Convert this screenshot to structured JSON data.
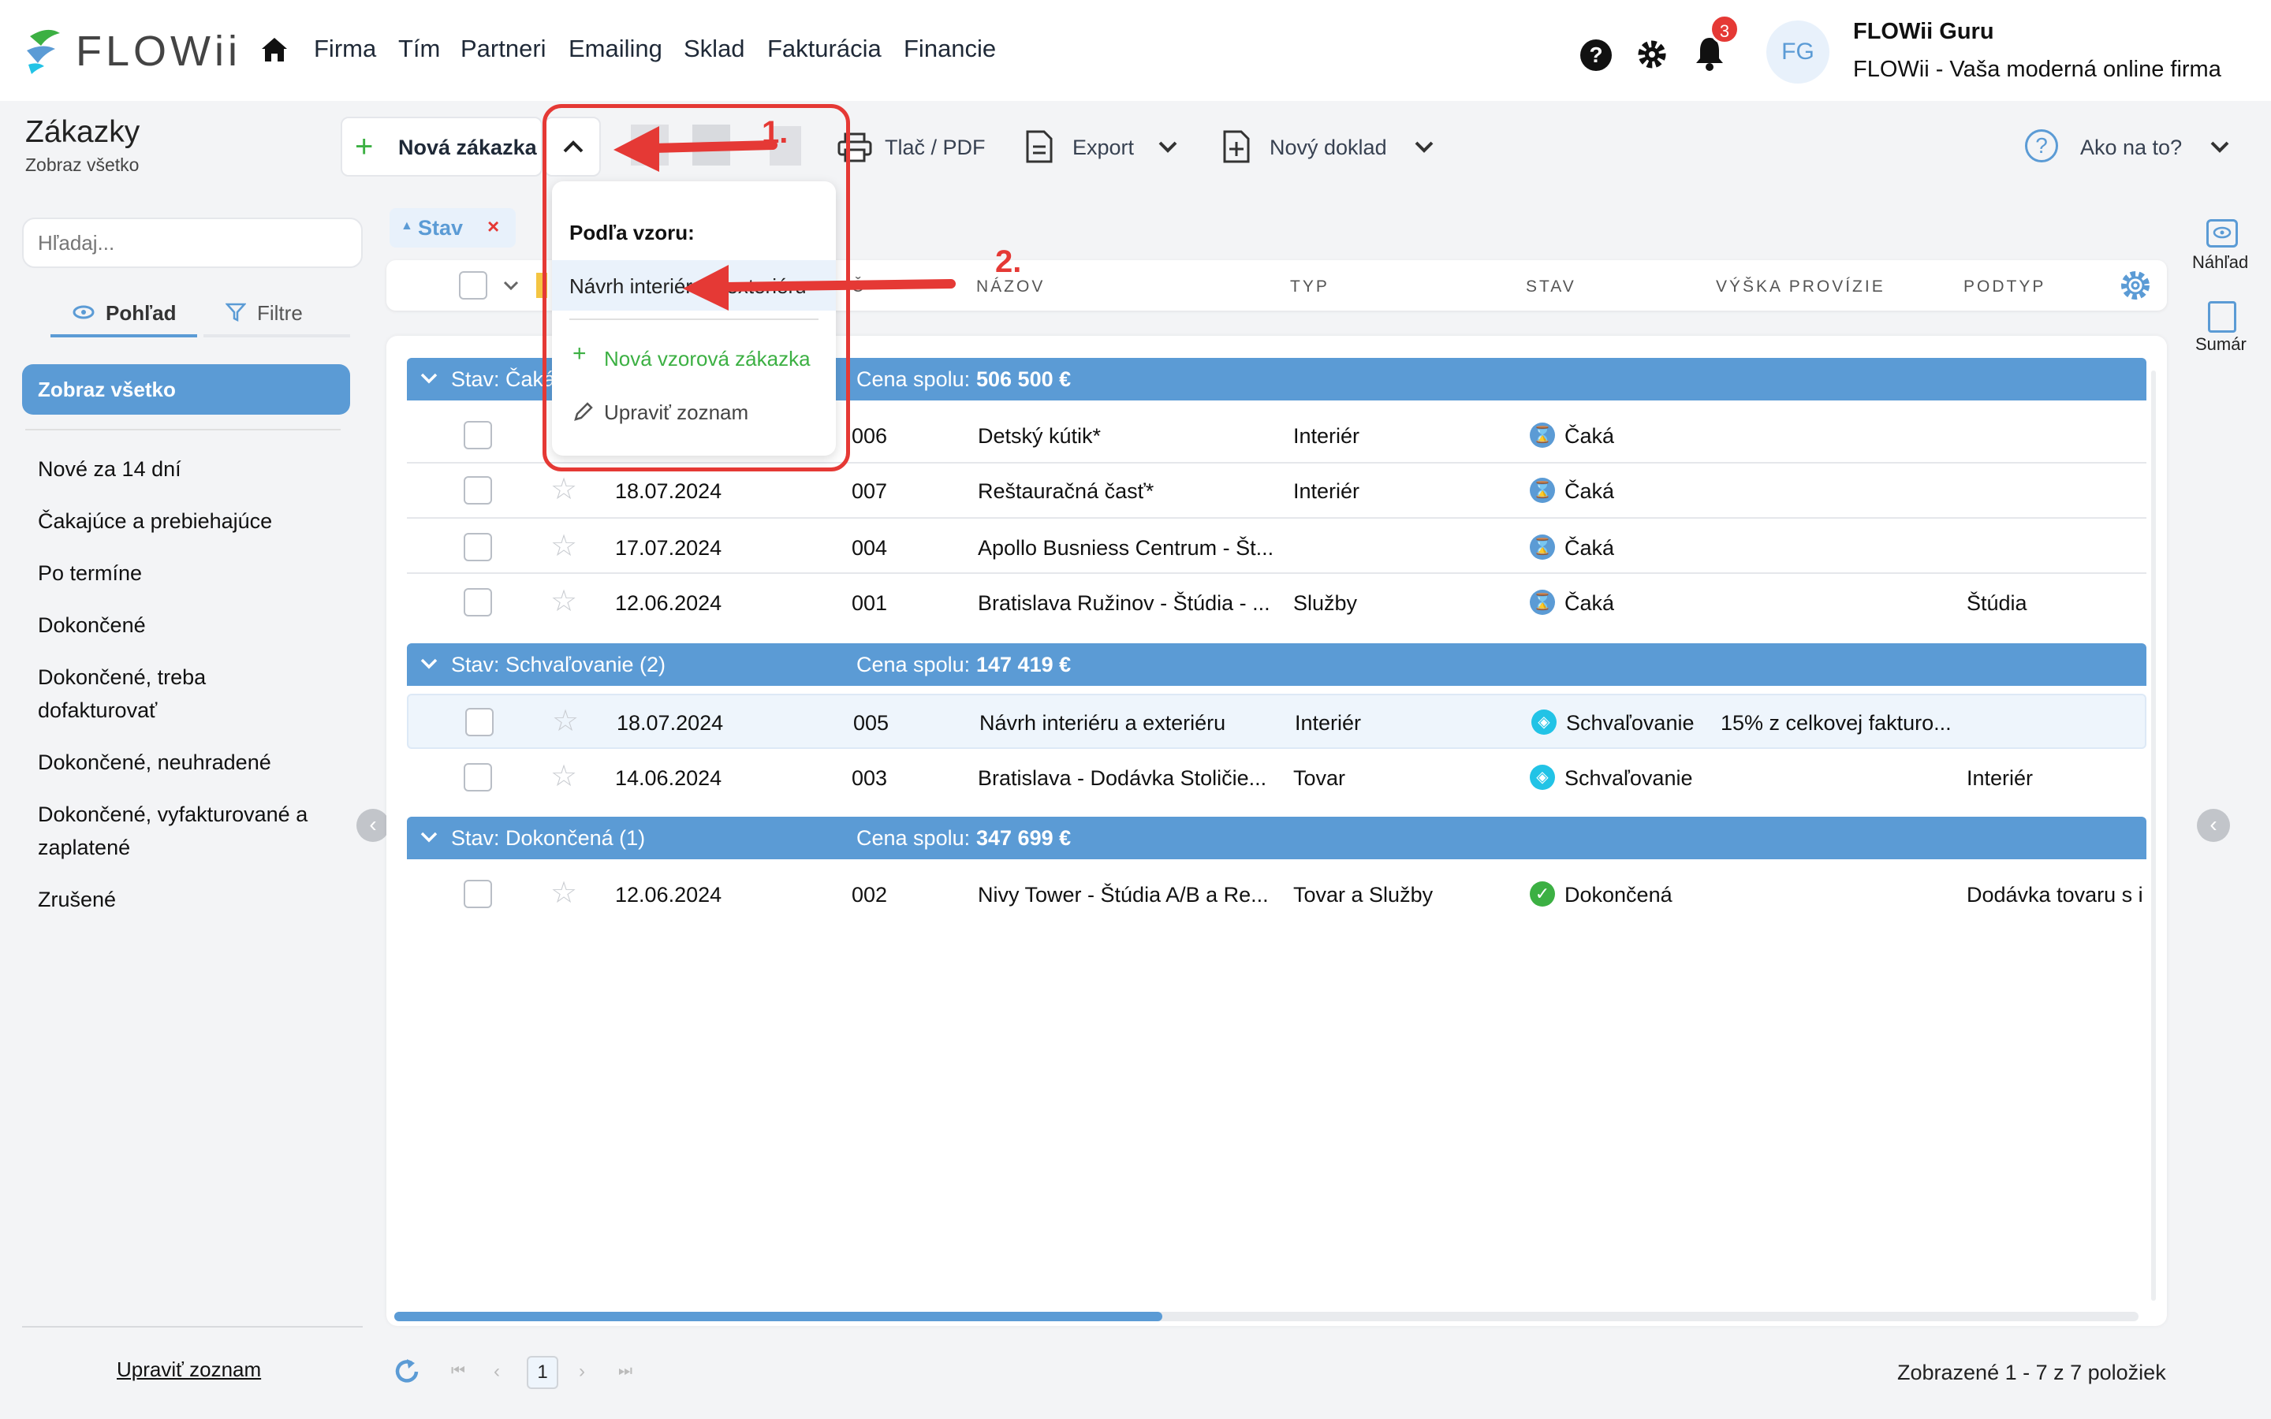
{
  "app": {
    "name": "FLOWii"
  },
  "nav": {
    "items": [
      "Firma",
      "Tím",
      "Partneri",
      "Emailing",
      "Sklad",
      "Fakturácia",
      "Financie"
    ]
  },
  "notifications": {
    "count": "3"
  },
  "user": {
    "initials": "FG",
    "name": "FLOWii Guru",
    "company": "FLOWii - Vaša moderná online firma"
  },
  "page": {
    "title": "Zákazky",
    "subtitle": "Zobraz všetko"
  },
  "toolbar": {
    "new_order": "Nová zákazka",
    "print": "Tlač / PDF",
    "export": "Export",
    "new_doc": "Nový doklad",
    "help": "Ako na to?"
  },
  "dropdown": {
    "heading": "Podľa vzoru:",
    "template_item": "Návrh interiéru a exteriéru",
    "new_template": "Nová vzorová zákazka",
    "edit_list": "Upraviť zoznam"
  },
  "annotations": {
    "one": "1.",
    "two": "2."
  },
  "sidebar": {
    "search_placeholder": "Hľadaj...",
    "tab_view": "Pohľad",
    "tab_filters": "Filtre",
    "active": "Zobraz všetko",
    "links": [
      "Nové za 14 dní",
      "Čakajúce a prebiehajúce",
      "Po termíne",
      "Dokončené",
      "Dokončené, treba dofakturovať",
      "Dokončené, neuhradené",
      "Dokončené, vyfakturované a zaplatené",
      "Zrušené"
    ],
    "edit_list": "Upraviť zoznam"
  },
  "filter_chip": {
    "label": "Stav"
  },
  "columns": {
    "name": "NÁZOV",
    "type": "TYP",
    "status": "STAV",
    "commission": "VÝŠKA PROVÍZIE",
    "subtype": "PODTYP"
  },
  "groups": [
    {
      "label": "Stav: Čaká (4)",
      "label_visible": "Stav: Čaká",
      "sum_label": "Cena spolu:",
      "sum": "506 500 €"
    },
    {
      "label": "Stav: Schvaľovanie (2)",
      "sum_label": "Cena spolu:",
      "sum": "147 419 €"
    },
    {
      "label": "Stav: Dokončená (1)",
      "sum_label": "Cena spolu:",
      "sum": "347 699 €"
    }
  ],
  "rows": [
    {
      "date": "",
      "num": "006",
      "name": "Detský kútik*",
      "type": "Interiér",
      "status": "Čaká",
      "commission": "",
      "subtype": ""
    },
    {
      "date": "18.07.2024",
      "num": "007",
      "name": "Reštauračná časť*",
      "type": "Interiér",
      "status": "Čaká",
      "commission": "",
      "subtype": ""
    },
    {
      "date": "17.07.2024",
      "num": "004",
      "name": "Apollo Busniess Centrum - Št...",
      "type": "",
      "status": "Čaká",
      "commission": "",
      "subtype": ""
    },
    {
      "date": "12.06.2024",
      "num": "001",
      "name": "Bratislava Ružinov - Štúdia - ...",
      "type": "Služby",
      "status": "Čaká",
      "commission": "",
      "subtype": "Štúdia"
    },
    {
      "date": "18.07.2024",
      "num": "005",
      "name": "Návrh interiéru a exteriéru",
      "type": "Interiér",
      "status": "Schvaľovanie",
      "commission": "15% z celkovej fakturo...",
      "subtype": ""
    },
    {
      "date": "14.06.2024",
      "num": "003",
      "name": "Bratislava - Dodávka Stoličie...",
      "type": "Tovar",
      "status": "Schvaľovanie",
      "commission": "",
      "subtype": "Interiér"
    },
    {
      "date": "12.06.2024",
      "num": "002",
      "name": "Nivy Tower - Štúdia A/B a Re...",
      "type": "Tovar a Služby",
      "status": "Dokončená",
      "commission": "",
      "subtype": "Dodávka tovaru s i"
    }
  ],
  "right_panel": {
    "preview": "Náhľad",
    "summary": "Sumár"
  },
  "pagination": {
    "current": "1",
    "summary": "Zobrazené 1 - 7 z 7 položiek"
  },
  "colors": {
    "accent": "#5b9bd5",
    "annotation": "#e53935",
    "green": "#3cb043"
  }
}
